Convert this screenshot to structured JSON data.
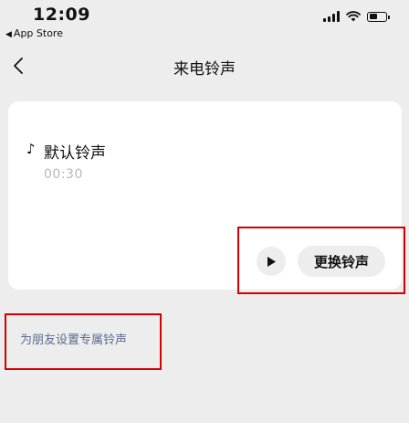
{
  "status_bar": {
    "time": "12:09",
    "back_app": "App Store",
    "battery_level": 0.55
  },
  "nav": {
    "title": "来电铃声"
  },
  "ringtone": {
    "name": "默认铃声",
    "duration": "00:30",
    "change_label": "更换铃声"
  },
  "friend_link": "为朋友设置专属铃声",
  "colors": {
    "background": "#ededed",
    "card": "#ffffff",
    "link": "#5b6b91",
    "highlight": "#d40000"
  },
  "icons": [
    "back-chevron-icon",
    "music-note-icon",
    "play-icon",
    "signal-icon",
    "wifi-icon",
    "battery-icon"
  ]
}
